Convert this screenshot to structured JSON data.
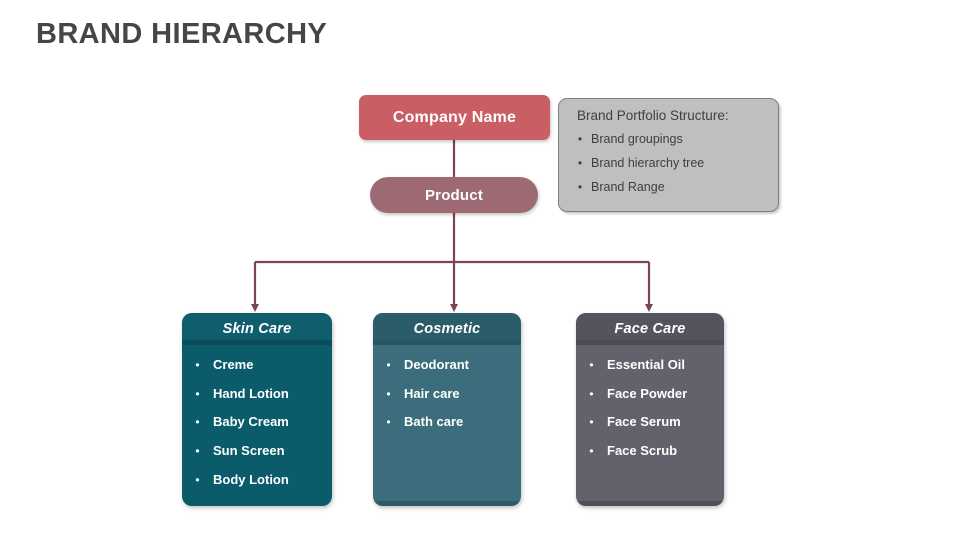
{
  "page": {
    "title": "BRAND HIERARCHY",
    "background": "#ffffff",
    "title_color": "#464646"
  },
  "hierarchy": {
    "root": {
      "label": "Company Name",
      "color": "#c95f64",
      "shape": "rounded-rectangle"
    },
    "level2": {
      "label": "Product",
      "color": "#9d6a74",
      "shape": "pill"
    },
    "connector_color": "#7a4650"
  },
  "legend": {
    "title": "Brand Portfolio Structure:",
    "bullet": "•",
    "fill_color": "#bfbfbf",
    "border_color": "#7f7f7f",
    "text_color": "#3f3f3f",
    "items": [
      {
        "label": "Brand groupings"
      },
      {
        "label": "Brand hierarchy tree"
      },
      {
        "label": "Brand Range"
      }
    ]
  },
  "categories": [
    {
      "id": "skin-care",
      "header": "Skin Care",
      "header_color": "#0f5e6e",
      "body_color": "#0a5c6b",
      "divider_color": "#0a4c59",
      "footer_color": "#0a5c6b",
      "bullet": "•",
      "items": [
        {
          "label": "Creme"
        },
        {
          "label": "Hand Lotion"
        },
        {
          "label": "Baby Cream"
        },
        {
          "label": "Sun Screen"
        },
        {
          "label": "Body Lotion"
        }
      ]
    },
    {
      "id": "cosmetic",
      "header": "Cosmetic",
      "header_color": "#2a5c6a",
      "body_color": "#3b6d7c",
      "divider_color": "#2a5663",
      "footer_color": "#2f5965",
      "bullet": "•",
      "items": [
        {
          "label": "Deodorant"
        },
        {
          "label": "Hair care"
        },
        {
          "label": "Bath care"
        }
      ]
    },
    {
      "id": "face-care",
      "header": "Face Care",
      "header_color": "#54545e",
      "body_color": "#62626d",
      "divider_color": "#4c4c56",
      "footer_color": "#4f4f59",
      "bullet": "•",
      "items": [
        {
          "label": "Essential Oil"
        },
        {
          "label": "Face Powder"
        },
        {
          "label": "Face Serum"
        },
        {
          "label": "Face Scrub"
        }
      ]
    }
  ]
}
